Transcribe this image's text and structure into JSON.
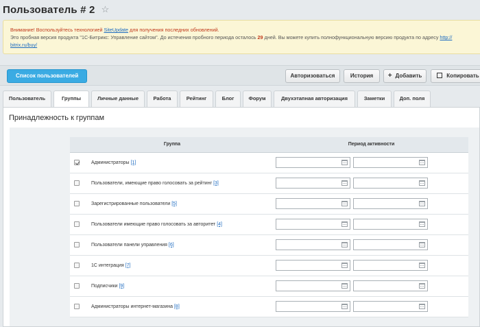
{
  "header": {
    "title": "Пользователь # 2",
    "star_icon": "star-icon"
  },
  "notice": {
    "warning_prefix": "Внимание! Воспользуйтесь технологией ",
    "warning_link": "SiteUpdate",
    "warning_suffix": " для получения последних обновлений.",
    "trial_text_1": "Это пробная версия продукта \"1С-Битрикс: Управление сайтом\". До истечения пробного периода осталось ",
    "trial_days": "29",
    "trial_text_2": " дней. Вы можете купить полнофункциональную версию продукта по адресу ",
    "trial_link_1": "http://",
    "trial_link_2": "bitrix.ru/buy/"
  },
  "toolbar": {
    "list_button": "Список пользователей",
    "authorize": "Авторизоваться",
    "history": "История",
    "add": "Добавить",
    "copy": "Копировать"
  },
  "tabs": [
    "Пользователь",
    "Группы",
    "Личные данные",
    "Работа",
    "Рейтинг",
    "Блог",
    "Форум",
    "Двухэтапная авторизация",
    "Заметки",
    "Доп. поля"
  ],
  "active_tab": "Группы",
  "section": {
    "title": "Принадлежность к группам",
    "col_group": "Группа",
    "col_period": "Период активности",
    "rows": [
      {
        "name": "Администраторы",
        "id": "[1]",
        "checked": true
      },
      {
        "name": "Пользователи, имеющие право голосовать за рейтинг",
        "id": "[3]",
        "checked": false
      },
      {
        "name": "Зарегистрированные пользователи",
        "id": "[5]",
        "checked": false
      },
      {
        "name": "Пользователи имеющие право голосовать за авторитет",
        "id": "[4]",
        "checked": false
      },
      {
        "name": "Пользователи панели управления",
        "id": "[6]",
        "checked": false
      },
      {
        "name": "1С интеграция",
        "id": "[7]",
        "checked": false
      },
      {
        "name": "Подписчики",
        "id": "[9]",
        "checked": false
      },
      {
        "name": "Администраторы интернет-магазина",
        "id": "[8]",
        "checked": false
      }
    ]
  },
  "colors": {
    "accent": "#3aabe3",
    "link": "#1b6ac0",
    "warning": "#c0391b",
    "notice_bg": "#fbf6d6"
  }
}
